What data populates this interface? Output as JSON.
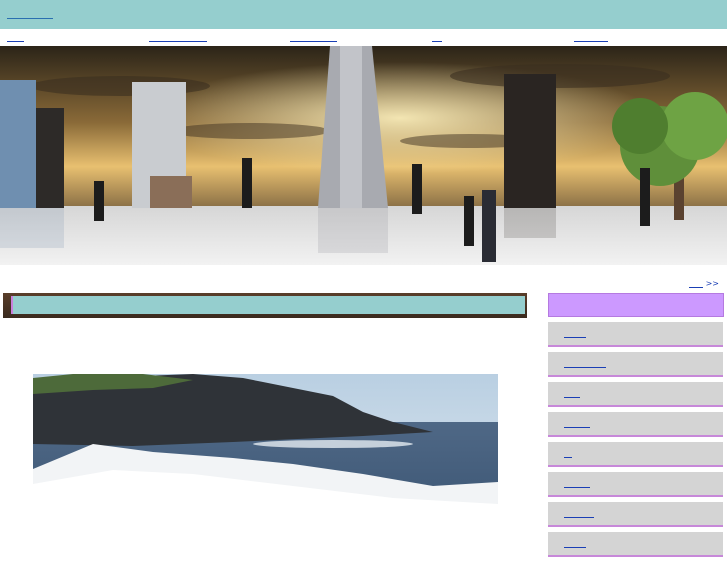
{
  "header": {
    "link_label": ""
  },
  "nav": {
    "items": [
      "",
      "",
      "",
      "",
      ""
    ]
  },
  "banner": {
    "description": ""
  },
  "more_link": {
    "label": "",
    "arrows": ">>"
  },
  "main": {
    "title": ""
  },
  "sidebar": {
    "heading": "",
    "items": [
      "",
      "",
      "",
      "",
      "",
      "",
      "",
      ""
    ]
  }
}
